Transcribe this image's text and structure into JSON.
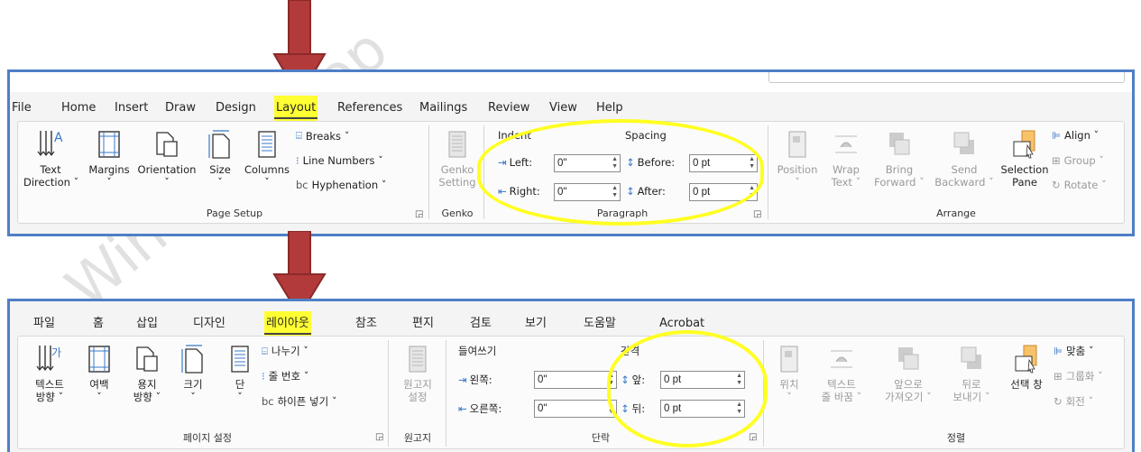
{
  "watermark": "WindowsLoop",
  "english": {
    "tabs": [
      "File",
      "Home",
      "Insert",
      "Draw",
      "Design",
      "Layout",
      "References",
      "Mailings",
      "Review",
      "View",
      "Help"
    ],
    "active_tab": "Layout",
    "page_setup": {
      "text_direction": [
        "Text",
        "Direction ˇ"
      ],
      "margins": [
        "Margins",
        "ˇ"
      ],
      "orientation": [
        "Orientation",
        "ˇ"
      ],
      "size": [
        "Size",
        "ˇ"
      ],
      "columns": [
        "Columns",
        "ˇ"
      ],
      "breaks": "Breaks ˇ",
      "line_numbers": "Line Numbers ˇ",
      "hyphenation": "Hyphenation ˇ",
      "label": "Page Setup"
    },
    "genko": {
      "button": [
        "Genko",
        "Setting"
      ],
      "label": "Genko"
    },
    "paragraph": {
      "indent": "Indent",
      "spacing": "Spacing",
      "left_label": "Left:",
      "left_value": "0\"",
      "right_label": "Right:",
      "right_value": "0\"",
      "before_label": "Before:",
      "before_value": "0 pt",
      "after_label": "After:",
      "after_value": "0 pt",
      "label": "Paragraph"
    },
    "arrange": {
      "position": [
        "Position",
        "ˇ"
      ],
      "wrap": [
        "Wrap",
        "Text ˇ"
      ],
      "bring": [
        "Bring",
        "Forward ˇ"
      ],
      "send": [
        "Send",
        "Backward ˇ"
      ],
      "selection": [
        "Selection",
        "Pane"
      ],
      "align": "Align ˇ",
      "group": "Group ˇ",
      "rotate": "Rotate ˇ",
      "label": "Arrange"
    }
  },
  "korean": {
    "tabs": [
      "파일",
      "홈",
      "삽입",
      "디자인",
      "레이아웃",
      "참조",
      "편지",
      "검토",
      "보기",
      "도움말",
      "Acrobat"
    ],
    "active_tab": "레이아웃",
    "page_setup": {
      "text_direction": [
        "텍스트",
        "방향 ˇ"
      ],
      "margins": [
        "여백",
        "ˇ"
      ],
      "orientation": [
        "용지",
        "방향 ˇ"
      ],
      "size": [
        "크기",
        "ˇ"
      ],
      "columns": [
        "단",
        "ˇ"
      ],
      "breaks": "나누기 ˇ",
      "line_numbers": "줄 번호 ˇ",
      "hyphenation": "하이픈 넣기 ˇ",
      "label": "페이지 설정"
    },
    "genko": {
      "button": [
        "원고지",
        "설정"
      ],
      "label": "원고지"
    },
    "paragraph": {
      "indent": "들여쓰기",
      "spacing": "간격",
      "left_label": "왼쪽:",
      "left_value": "0\"",
      "right_label": "오른쪽:",
      "right_value": "0\"",
      "before_label": "앞:",
      "before_value": "0 pt",
      "after_label": "뒤:",
      "after_value": "0 pt",
      "label": "단락"
    },
    "arrange": {
      "position": [
        "위치",
        "ˇ"
      ],
      "wrap": [
        "텍스트",
        "줄 바꿈 ˇ"
      ],
      "bring": [
        "앞으로",
        "가져오기 ˇ"
      ],
      "send": [
        "뒤로",
        "보내기 ˇ"
      ],
      "selection": [
        "선택 창",
        ""
      ],
      "align": "맞춤 ˇ",
      "group": "그룹화 ˇ",
      "rotate": "회전 ˇ",
      "label": "정렬"
    }
  },
  "colors": {
    "panel_border": "#4f7fc6",
    "highlight": "#ffff22",
    "arrow": "#b33a3a"
  }
}
